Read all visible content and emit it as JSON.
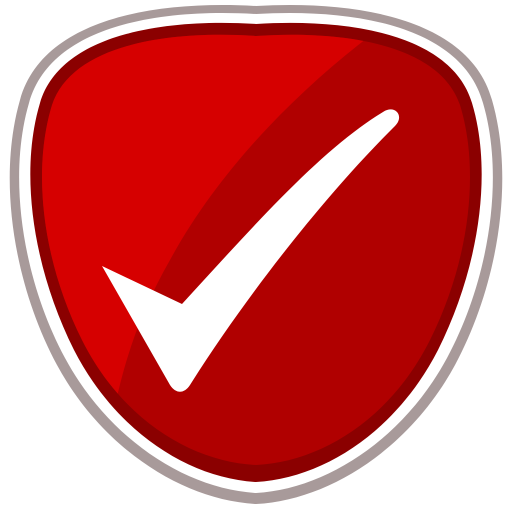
{
  "badge": {
    "icon": "check-shield-icon",
    "colors": {
      "outer_ring": "#A89A9A",
      "white_ring": "#FFFFFF",
      "dark_rim": "#8B0000",
      "red_highlight": "#D60000",
      "red_shadow": "#B00000",
      "check": "#FFFFFF"
    }
  }
}
